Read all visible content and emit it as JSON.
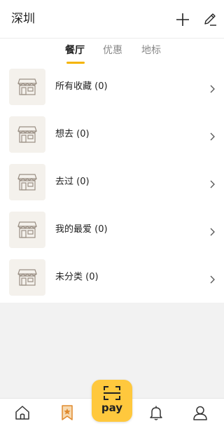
{
  "header": {
    "city": "深圳",
    "add_icon": "plus-icon",
    "edit_icon": "pencil-icon"
  },
  "tabs": [
    {
      "label": "餐厅",
      "active": true
    },
    {
      "label": "优惠",
      "active": false
    },
    {
      "label": "地标",
      "active": false
    }
  ],
  "accent_color": "#f5b400",
  "list": {
    "items": [
      {
        "label": "所有收藏 (0)",
        "icon": "storefront-icon"
      },
      {
        "label": "想去 (0)",
        "icon": "storefront-icon"
      },
      {
        "label": "去过 (0)",
        "icon": "storefront-icon"
      },
      {
        "label": "我的最爱 (0)",
        "icon": "storefront-icon"
      },
      {
        "label": "未分类 (0)",
        "icon": "storefront-icon"
      }
    ]
  },
  "bottom_nav": {
    "items": [
      {
        "name": "home",
        "icon": "home-icon"
      },
      {
        "name": "favorites",
        "icon": "bookmark-star-icon",
        "active": true
      },
      {
        "name": "pay",
        "label": "pay",
        "icon": "scan-icon"
      },
      {
        "name": "notifications",
        "icon": "bell-icon"
      },
      {
        "name": "profile",
        "icon": "user-icon"
      }
    ]
  }
}
